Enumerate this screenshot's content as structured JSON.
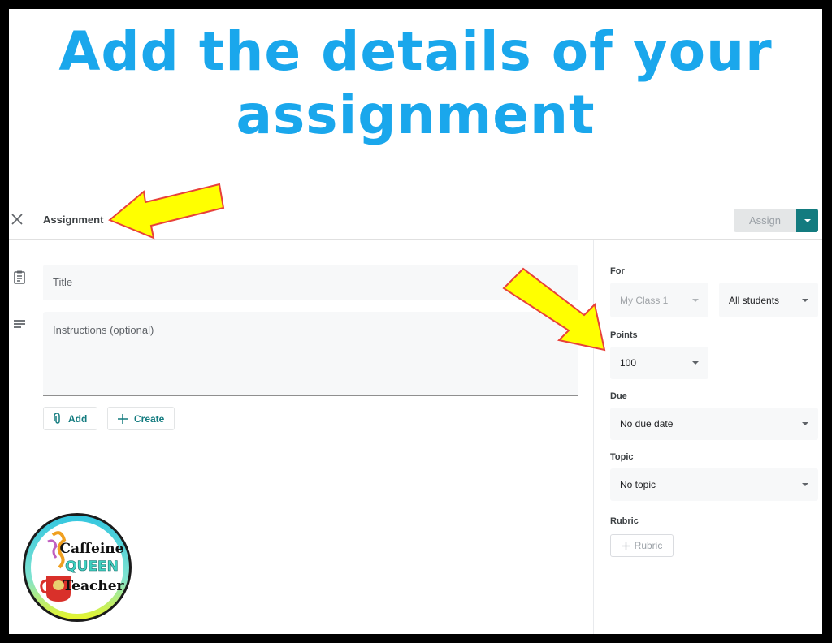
{
  "headline": {
    "line1": "Add the details of your",
    "line2": "assignment",
    "color": "#1aa7ec"
  },
  "topbar": {
    "close_icon": "close-icon",
    "title": "Assignment",
    "assign_label": "Assign",
    "assign_menu_icon": "chevron-down-icon"
  },
  "form": {
    "title_placeholder": "Title",
    "title_value": "",
    "instructions_placeholder": "Instructions (optional)",
    "instructions_value": "",
    "title_icon": "clipboard-icon",
    "instructions_icon": "notes-lines-icon",
    "add_label": "Add",
    "add_icon": "paperclip-icon",
    "create_label": "Create",
    "create_icon": "plus-icon"
  },
  "settings": {
    "for_label": "For",
    "class_value": "My Class 1",
    "students_value": "All students",
    "points_label": "Points",
    "points_value": "100",
    "due_label": "Due",
    "due_value": "No due date",
    "topic_label": "Topic",
    "topic_value": "No topic",
    "rubric_label": "Rubric",
    "rubric_button": "Rubric"
  },
  "annotations": {
    "arrow_color": "#ffff00",
    "arrow_outline": "#e8413a"
  },
  "logo": {
    "line1": "Caffeine",
    "line2": "QUEEN",
    "line3": "Teacher"
  },
  "colors": {
    "accent": "#137b7f",
    "frame": "#000000"
  }
}
